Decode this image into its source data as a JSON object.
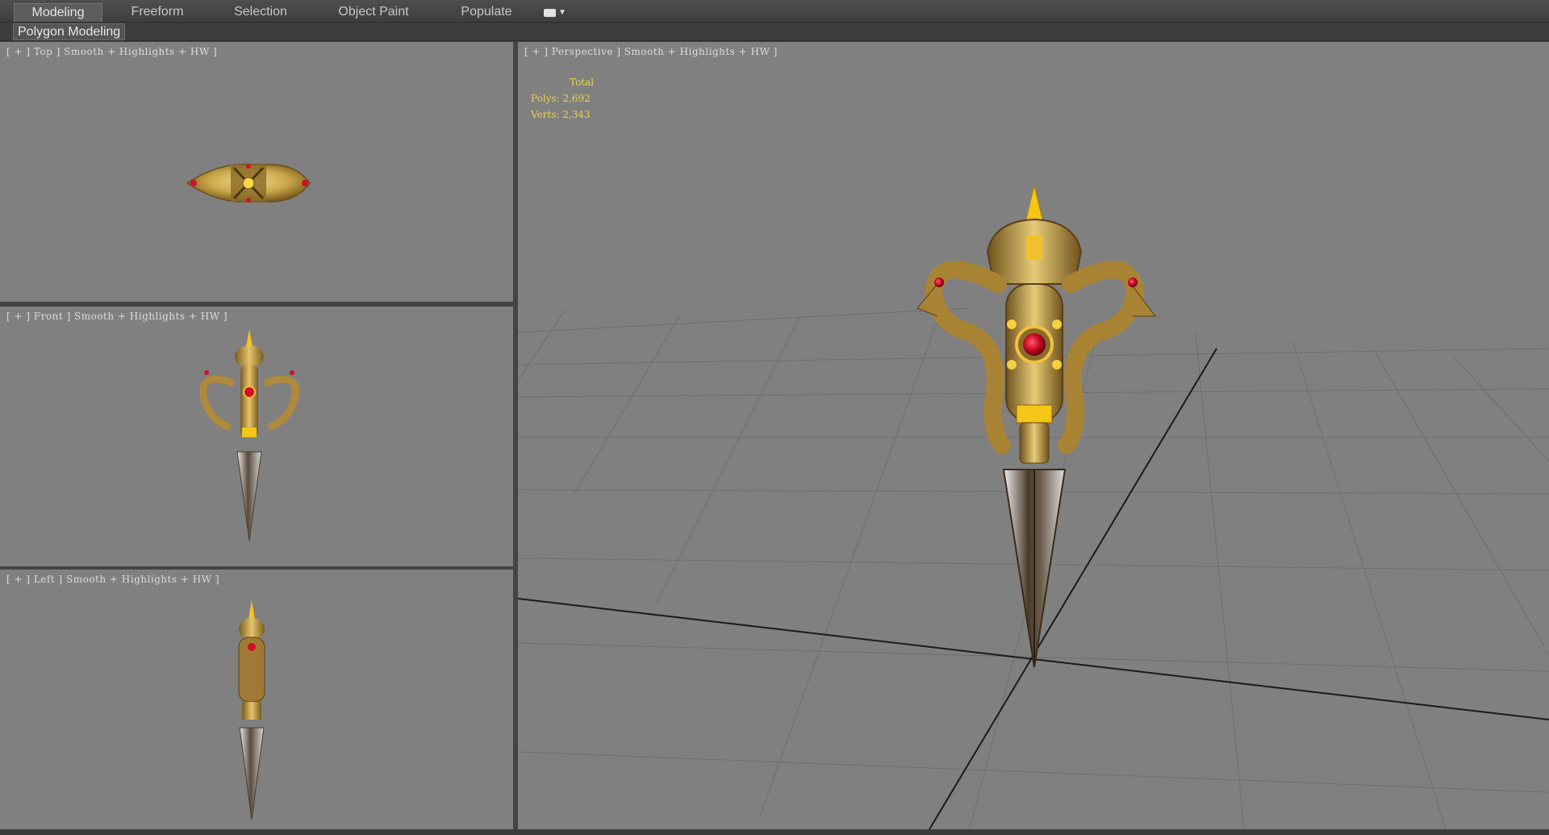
{
  "ribbon": {
    "tabs": [
      {
        "label": "Modeling",
        "active": true
      },
      {
        "label": "Freeform",
        "active": false
      },
      {
        "label": "Selection",
        "active": false
      },
      {
        "label": "Object Paint",
        "active": false
      },
      {
        "label": "Populate",
        "active": false
      }
    ],
    "panel_label": "Polygon Modeling"
  },
  "viewports": {
    "top": {
      "label": "[ + ] Top ] Smooth + Highlights + HW ]"
    },
    "front": {
      "label": "[ + ] Front ] Smooth + Highlights + HW ]"
    },
    "left": {
      "label": "[ + ] Left ] Smooth + Highlights + HW ]"
    },
    "perspective": {
      "label": "[ + ] Perspective ] Smooth + Highlights + HW ]"
    }
  },
  "stats": {
    "heading": "Total",
    "polys": "Polys: 2,692",
    "verts": "Verts: 2,343"
  },
  "colors": {
    "viewport_bg": "#808080",
    "gold": "#c9a548",
    "ruby": "#d0102a",
    "stats_text": "#e8d24a"
  }
}
